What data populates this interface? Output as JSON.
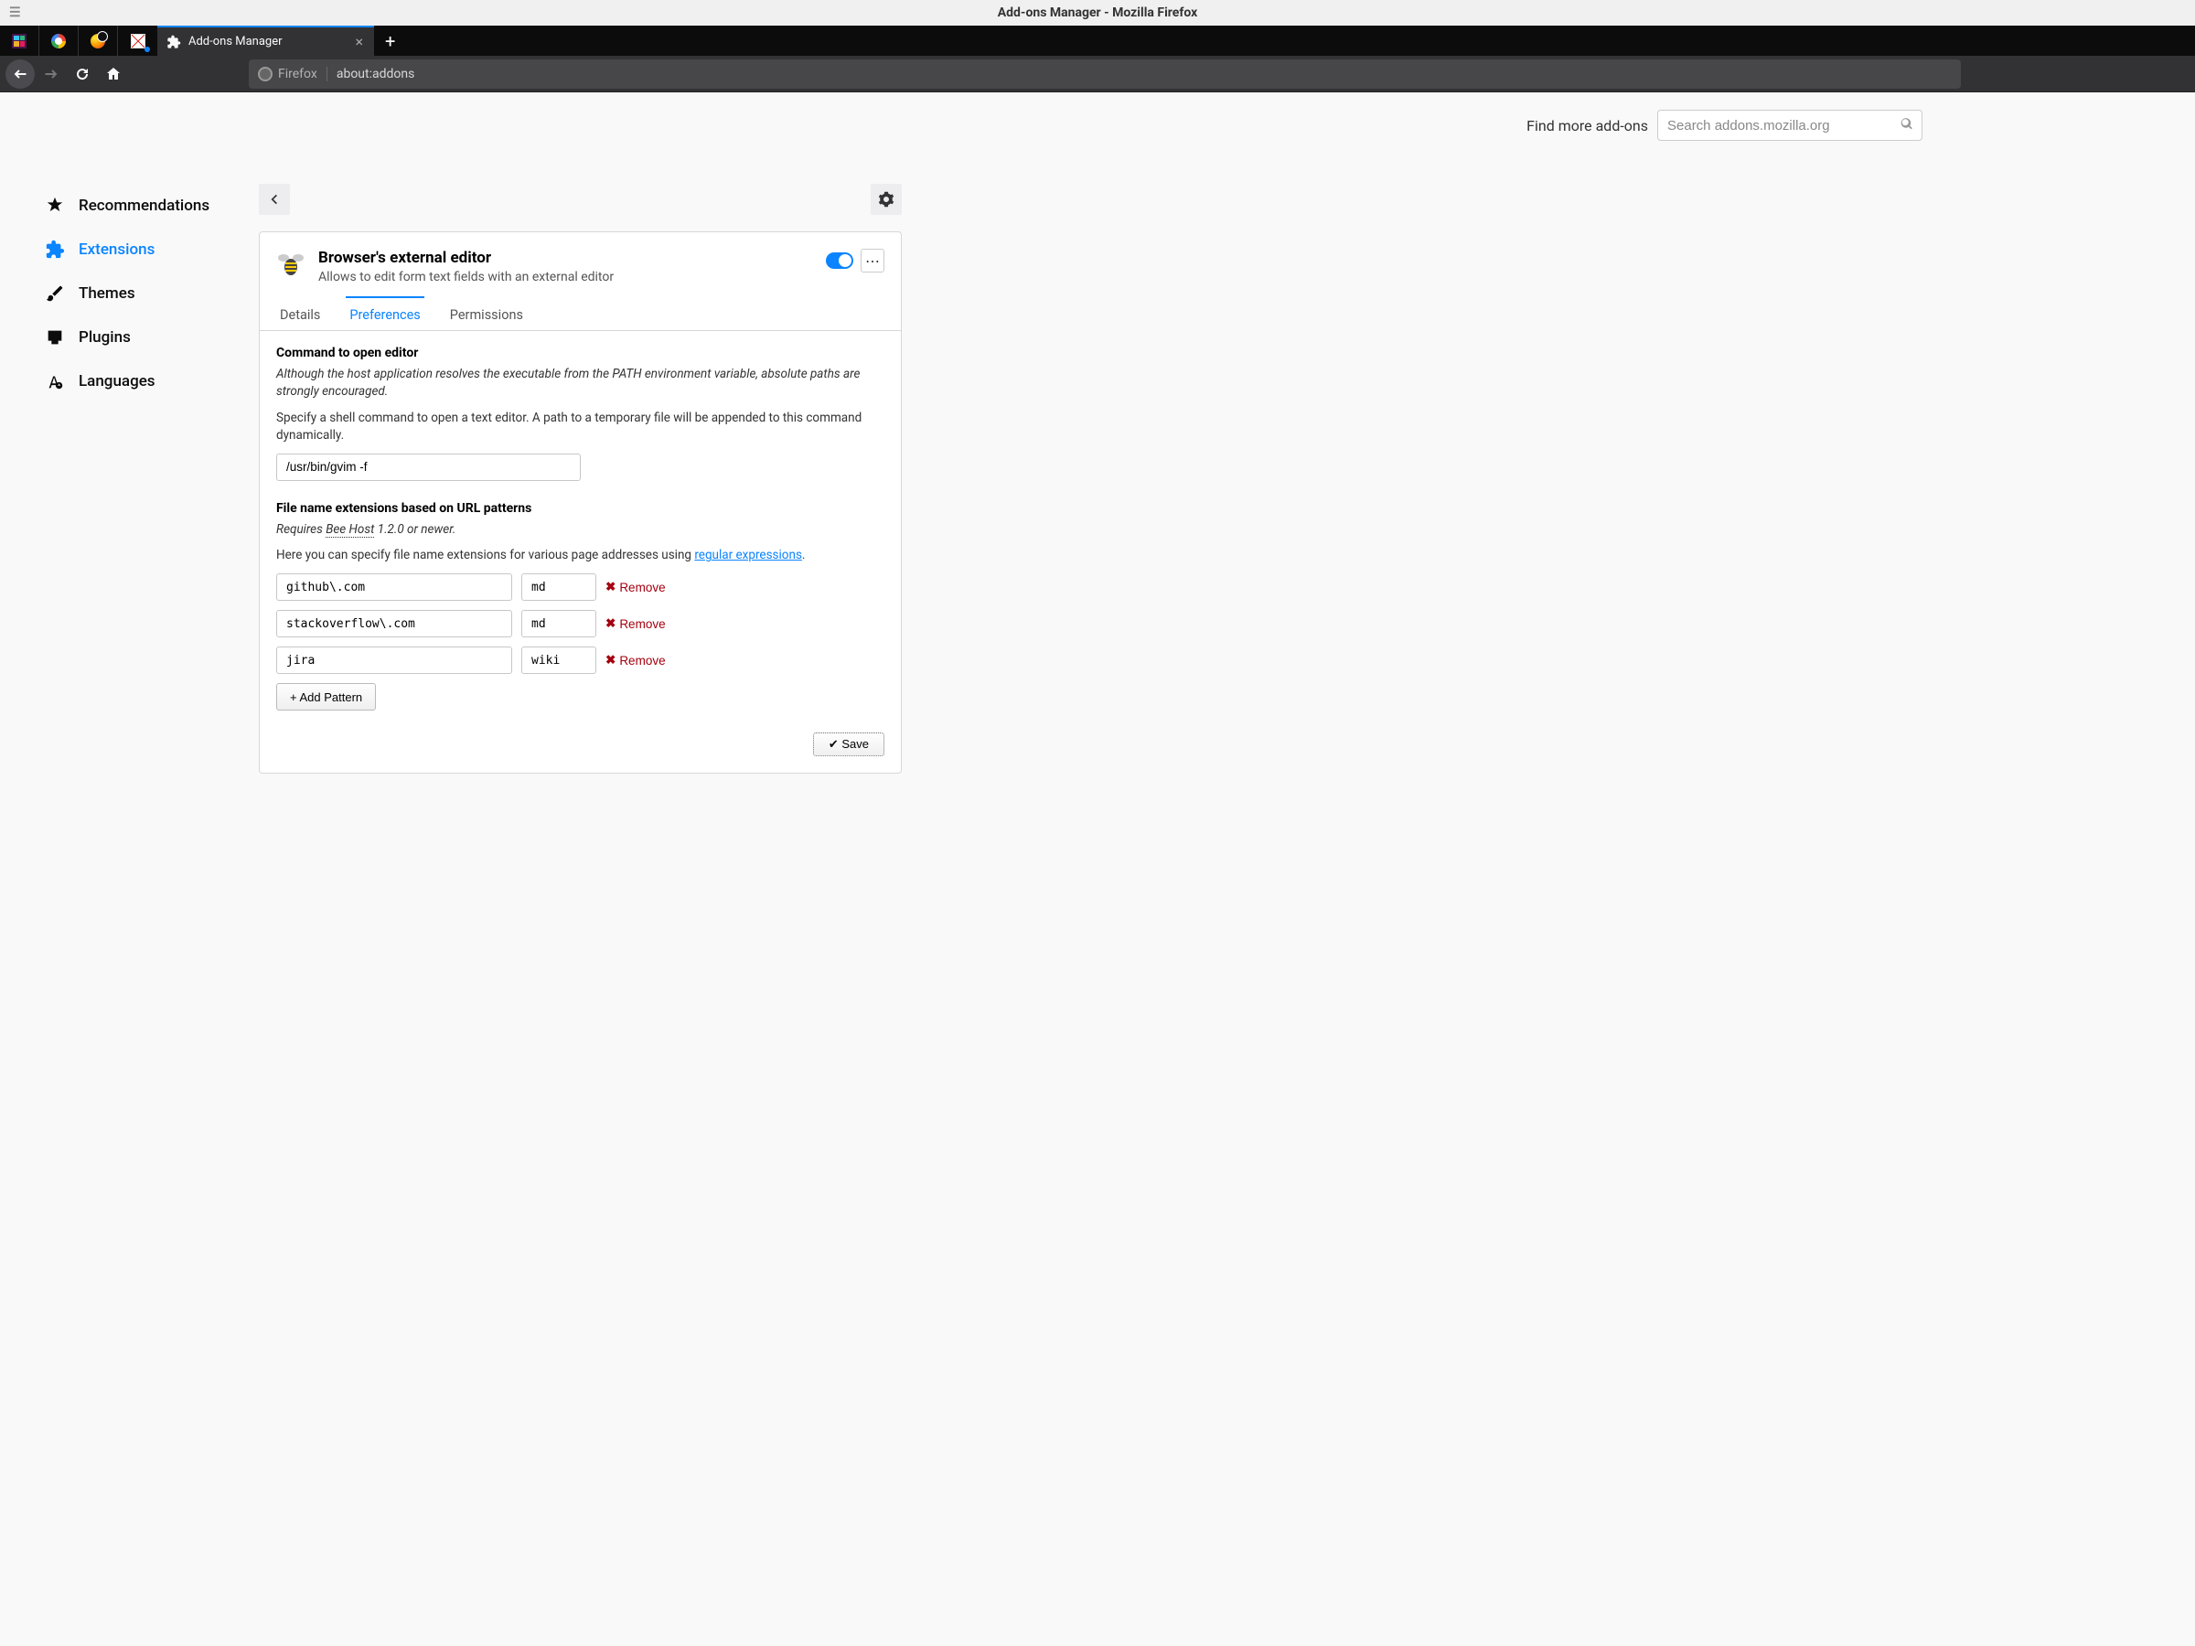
{
  "window": {
    "title": "Add-ons Manager - Mozilla Firefox"
  },
  "tab": {
    "label": "Add-ons Manager"
  },
  "urlbar": {
    "identity_label": "Firefox",
    "url": "about:addons"
  },
  "search": {
    "label": "Find more add-ons",
    "placeholder": "Search addons.mozilla.org"
  },
  "sidebar": {
    "items": [
      {
        "label": "Recommendations"
      },
      {
        "label": "Extensions"
      },
      {
        "label": "Themes"
      },
      {
        "label": "Plugins"
      },
      {
        "label": "Languages"
      }
    ]
  },
  "addon": {
    "name": "Browser's external editor",
    "description": "Allows to edit form text fields with an external editor"
  },
  "tabs": {
    "details": "Details",
    "preferences": "Preferences",
    "permissions": "Permissions"
  },
  "prefs": {
    "command_title": "Command to open editor",
    "command_note": "Although the host application resolves the executable from the PATH environment variable, absolute paths are strongly encouraged.",
    "command_text": "Specify a shell command to open a text editor. A path to a temporary file will be appended to this command dynamically.",
    "command_value": "/usr/bin/gvim -f",
    "patterns_title": "File name extensions based on URL patterns",
    "requires_prefix": "Requires ",
    "requires_link": "Bee Host",
    "requires_suffix": " 1.2.0 or newer.",
    "patterns_text_prefix": "Here you can specify file name extensions for various page addresses using ",
    "patterns_text_link": "regular expressions",
    "patterns_text_suffix": ".",
    "patterns": [
      {
        "pattern": "github\\.com",
        "ext": "md"
      },
      {
        "pattern": "stackoverflow\\.com",
        "ext": "md"
      },
      {
        "pattern": "jira",
        "ext": "wiki"
      }
    ],
    "remove_label": "Remove",
    "add_pattern_label": "+ Add Pattern",
    "save_label": "✔ Save"
  }
}
